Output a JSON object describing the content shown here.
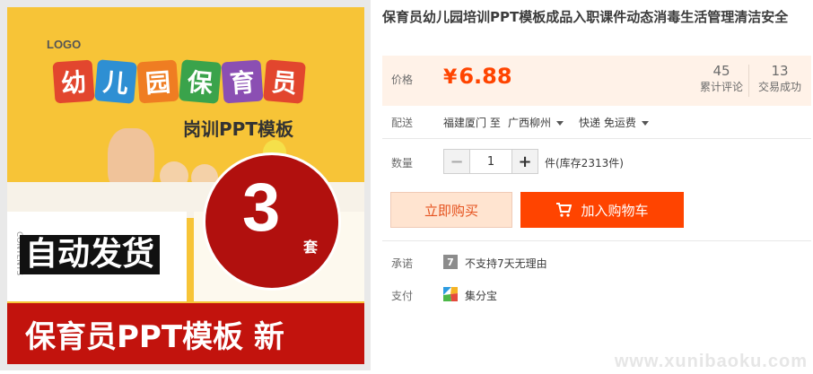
{
  "product_image": {
    "logo_text": "LOGO",
    "title_chars": [
      "幼",
      "儿",
      "园",
      "保",
      "育",
      "员"
    ],
    "title_tile_colors": [
      "#e2462e",
      "#2e8fd3",
      "#ef7d22",
      "#3aa34b",
      "#8b4fb3",
      "#e2462e"
    ],
    "subtitle": "岗训PPT模板",
    "contents_text": "CONTENTS",
    "set_count": "3",
    "set_unit": "套",
    "badge_text": "自动发货",
    "bottom_banner": "保育员PPT模板 新"
  },
  "product": {
    "title": "保育员幼儿园培训PPT模板成品入职课件动态消毒生活管理清洁安全"
  },
  "price_section": {
    "label": "价格",
    "currency_symbol": "¥",
    "price": "6.88",
    "reviews_count": "45",
    "reviews_label": "累计评论",
    "deals_count": "13",
    "deals_label": "交易成功"
  },
  "shipping": {
    "label": "配送",
    "from": "福建厦门 至",
    "to": "广西柳州",
    "method": "快递 免运费"
  },
  "quantity": {
    "label": "数量",
    "minus_label": "−",
    "plus_label": "+",
    "value": "1",
    "stock_text": "件(库存2313件)"
  },
  "actions": {
    "buy_now": "立即购买",
    "add_to_cart": "加入购物车"
  },
  "promise": {
    "label": "承诺",
    "icon_glyph": "7",
    "text": "不支持7天无理由"
  },
  "payment": {
    "label": "支付",
    "text": "集分宝"
  },
  "watermark": "www.xunibaoku.com",
  "colors": {
    "accent": "#ff4400",
    "price_bg": "#fff2e8",
    "buy_now_bg": "#ffe4d0",
    "image_bg": "#f7c437",
    "banner_red": "#c2130d"
  }
}
